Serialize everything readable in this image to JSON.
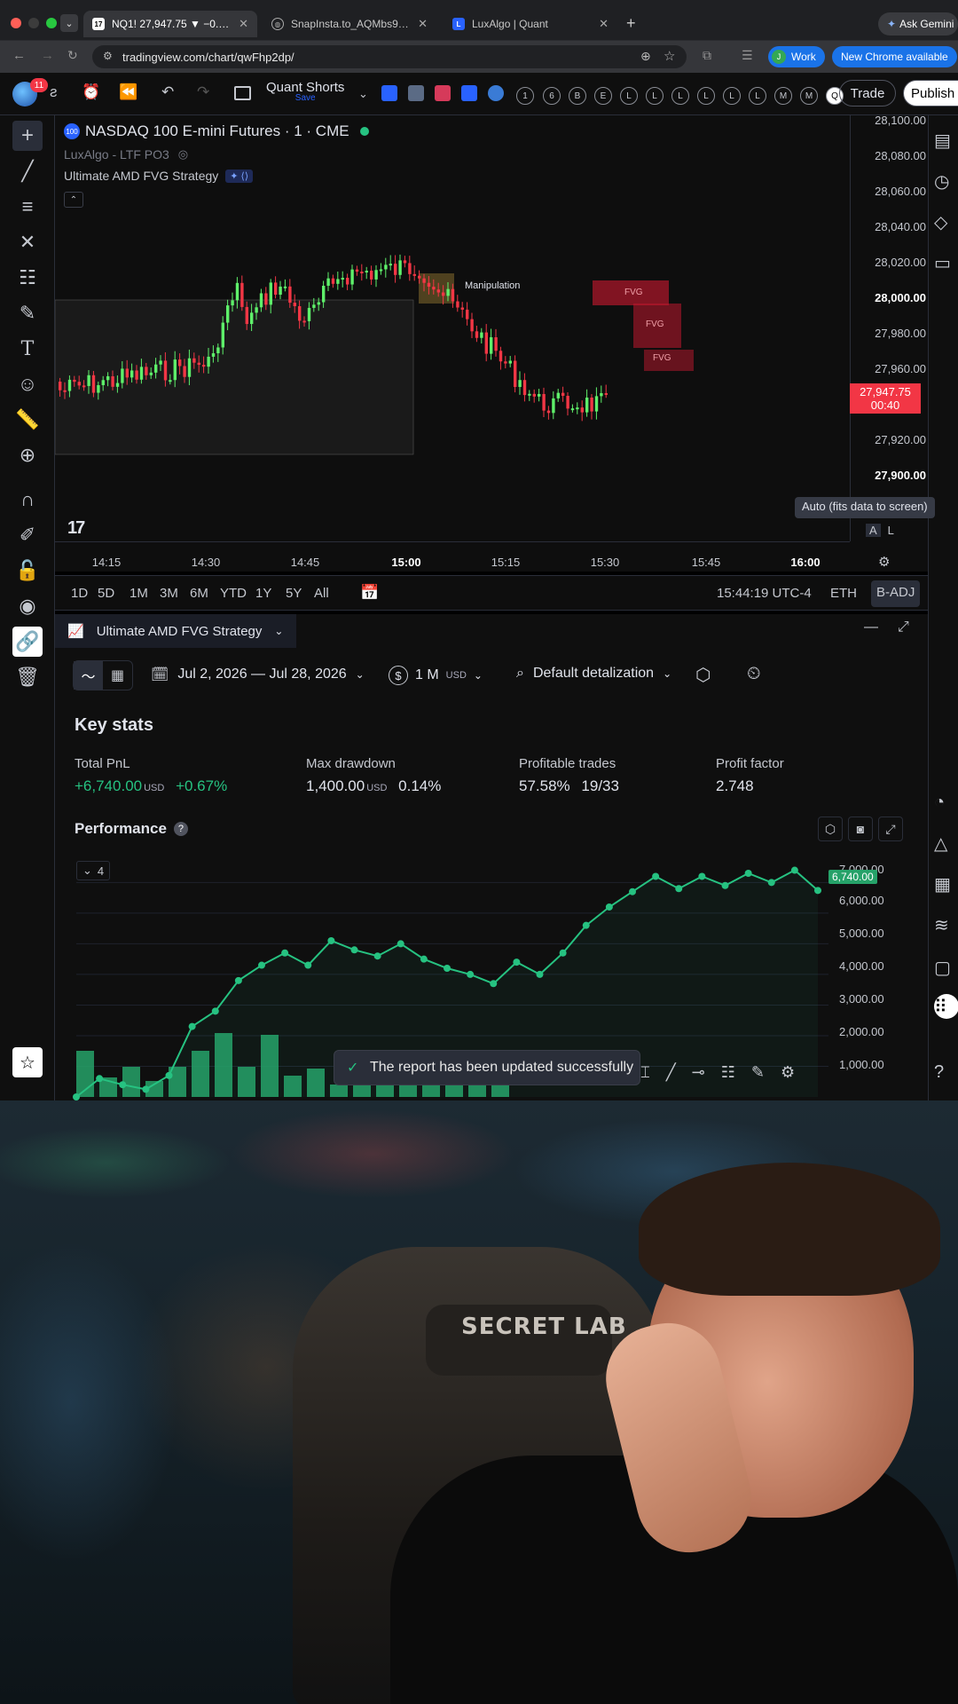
{
  "browser": {
    "tabs": [
      {
        "title": "NQ1! 27,947.75 ▼ −0.86% Q...",
        "active": true
      },
      {
        "title": "SnapInsta.to_AQMbs9kLtd4H...",
        "active": false
      },
      {
        "title": "LuxAlgo | Quant",
        "active": false
      }
    ],
    "url": "tradingview.com/chart/qwFhp2dp/",
    "profile_label": "Work",
    "update_label": "New Chrome available",
    "gemini_label": "Ask Gemini"
  },
  "toolbar": {
    "badge_count": "11",
    "layout_name": "Quant Shorts",
    "layout_sub": "Save",
    "letter_buttons": [
      "1",
      "6",
      "B",
      "E",
      "L",
      "L",
      "L",
      "L",
      "L",
      "L",
      "M",
      "M",
      "Q"
    ],
    "trade_label": "Trade",
    "publish_label": "Publish"
  },
  "chart": {
    "symbol_title": "NASDAQ 100 E-mini Futures · 1 · CME",
    "indicator_1": "LuxAlgo - LTF PO3",
    "indicator_2": "Ultimate AMD FVG Strategy",
    "annotation_manipulation": "Manipulation",
    "fvg_labels": [
      "FVG",
      "FVG",
      "FVG"
    ],
    "price_ticks": [
      "28,100.00",
      "28,080.00",
      "28,060.00",
      "28,040.00",
      "28,020.00",
      "28,000.00",
      "27,980.00",
      "27,960.00",
      "27,920.00",
      "27,900.00"
    ],
    "current_price": "27,947.75",
    "countdown": "00:40",
    "time_ticks": [
      "14:15",
      "14:30",
      "14:45",
      "15:00",
      "15:15",
      "15:30",
      "15:45",
      "16:00"
    ],
    "tooltip": "Auto (fits data to screen)",
    "btn_a": "A",
    "btn_l": "L",
    "colors": {
      "up": "#5ef06a",
      "down": "#f23645",
      "accent": "#2962ff"
    }
  },
  "rangebar": {
    "ranges": [
      "1D",
      "5D",
      "1M",
      "3M",
      "6M",
      "YTD",
      "1Y",
      "5Y",
      "All"
    ],
    "clock": "15:44:19 UTC-4",
    "session": "ETH",
    "adj": "B-ADJ"
  },
  "strategy_panel": {
    "tab_title": "Ultimate AMD FVG Strategy",
    "date_range": "Jul 2, 2026 — Jul 28, 2026",
    "capital": "1 M",
    "capital_unit": "USD",
    "detalization": "Default detalization",
    "key_stats_title": "Key stats",
    "stats": {
      "total_pnl_label": "Total PnL",
      "total_pnl_value": "+6,740.00",
      "total_pnl_unit": "USD",
      "total_pnl_pct": "+0.67%",
      "max_dd_label": "Max drawdown",
      "max_dd_value": "1,400.00",
      "max_dd_unit": "USD",
      "max_dd_pct": "0.14%",
      "profitable_label": "Profitable trades",
      "profitable_pct": "57.58%",
      "profitable_count": "19/33",
      "pf_label": "Profit factor",
      "pf_value": "2.748"
    },
    "performance_title": "Performance",
    "help_icon_glyph": "?",
    "collapse_count": "4",
    "y_ticks": [
      "7,000.00",
      "6,000.00",
      "5,000.00",
      "4,000.00",
      "3,000.00",
      "2,000.00",
      "1,000.00"
    ],
    "last_value": "6,740.00"
  },
  "chart_data": {
    "type": "line",
    "y": [
      0,
      600,
      400,
      250,
      700,
      2300,
      2800,
      3800,
      4300,
      4700,
      4300,
      5100,
      4800,
      4600,
      5000,
      4500,
      4200,
      4000,
      3700,
      4400,
      4000,
      4700,
      5600,
      6200,
      6700,
      7200,
      6800,
      7200,
      6900,
      7300,
      7000,
      7400,
      6740
    ],
    "ylim": [
      0,
      7300
    ]
  },
  "toast": {
    "message": "The report has been updated successfully"
  },
  "webcam": {
    "chair_brand": "SECRET LAB"
  }
}
